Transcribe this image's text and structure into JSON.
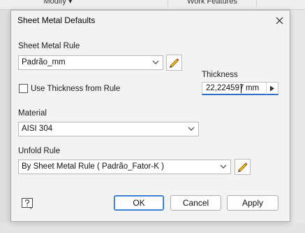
{
  "background": {
    "modify_tab": "Modify",
    "work_features_tab": "Work Features"
  },
  "dialog": {
    "title": "Sheet Metal Defaults",
    "sheet_metal_rule": {
      "label": "Sheet Metal Rule",
      "value": "Padrão_mm"
    },
    "use_thickness": {
      "label": "Use Thickness from Rule",
      "checked": false
    },
    "thickness": {
      "label": "Thickness",
      "value": "22,224597",
      "unit": "mm"
    },
    "material": {
      "label": "Material",
      "value": "AISI 304"
    },
    "unfold_rule": {
      "label": "Unfold Rule",
      "value": "By Sheet Metal Rule ( Padrão_Fator-K )"
    },
    "buttons": {
      "ok": "OK",
      "cancel": "Cancel",
      "apply": "Apply"
    },
    "icons": {
      "close": "close-icon",
      "edit": "pencil-icon",
      "help": "help-icon",
      "chevron": "chevron-down-icon",
      "arrow": "play-arrow-icon"
    },
    "colors": {
      "focus_accent": "#2a6fc9",
      "pencil_yellow": "#f2c21b"
    }
  }
}
